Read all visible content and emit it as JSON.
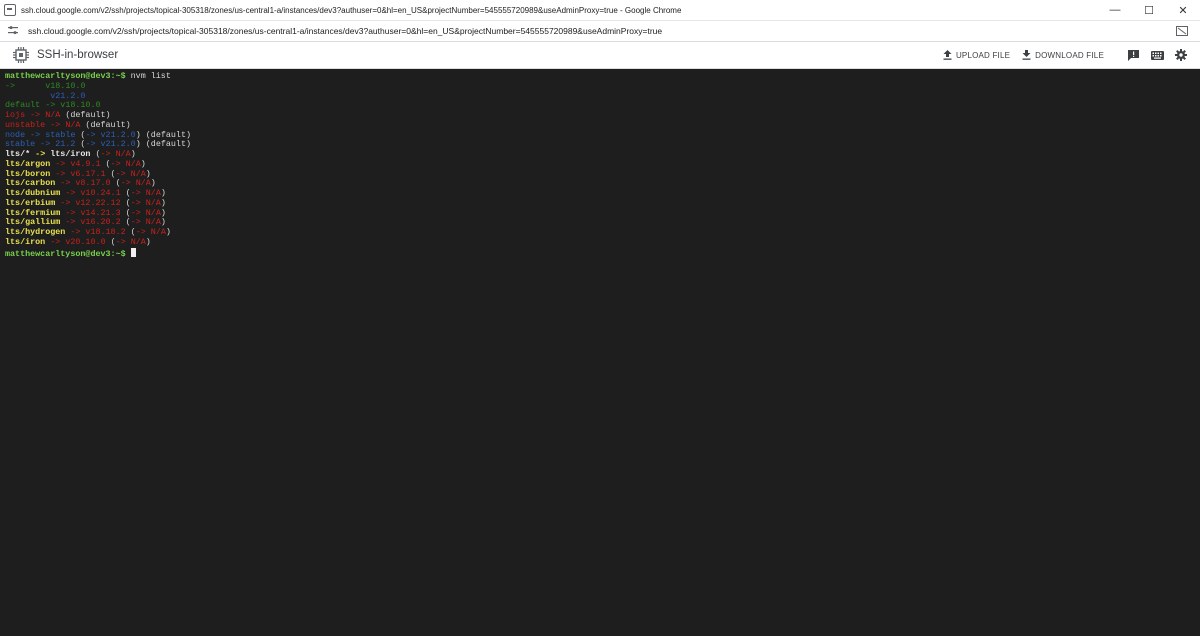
{
  "window": {
    "title": "ssh.cloud.google.com/v2/ssh/projects/topical-305318/zones/us-central1-a/instances/dev3?authuser=0&hl=en_US&projectNumber=545555720989&useAdminProxy=true - Google Chrome",
    "controls": {
      "minimize": "—",
      "maximize": "☐",
      "close": "✕"
    }
  },
  "address_bar": {
    "url": "ssh.cloud.google.com/v2/ssh/projects/topical-305318/zones/us-central1-a/instances/dev3?authuser=0&hl=en_US&projectNumber=545555720989&useAdminProxy=true"
  },
  "app_bar": {
    "title": "SSH-in-browser",
    "upload_label": "UPLOAD FILE",
    "download_label": "DOWNLOAD FILE",
    "icons": [
      "chip-icon",
      "upload-icon",
      "download-icon",
      "feedback-icon",
      "keyboard-icon",
      "gear-icon"
    ]
  },
  "terminal": {
    "prompt": "matthewcarltyson@dev3:~$",
    "command": " nvm list",
    "lines": {
      "l1": {
        "arrow": "->",
        "pad": "      ",
        "ver": "v18.10.0"
      },
      "l2": {
        "pad": "         ",
        "ver": "v21.2.0"
      },
      "l3": {
        "name": "default",
        "arrow": " -> ",
        "ver": "v18.10.0"
      },
      "l4": {
        "name": "iojs",
        "arrow": " -> ",
        "val": "N/A",
        "suffix": " (default)"
      },
      "l5": {
        "name": "unstable",
        "arrow": " -> ",
        "val": "N/A",
        "suffix": " (default)"
      },
      "l6": {
        "name": "node",
        "arrow": " -> ",
        "val": "stable",
        "open": " (",
        "arrow2": "->",
        "ver": " v21.2.0",
        "close": ")",
        "suffix": " (default)"
      },
      "l7": {
        "name": "stable",
        "arrow": " -> ",
        "val": "21.2",
        "open": " (",
        "arrow2": "->",
        "ver": " v21.2.0",
        "close": ")",
        "suffix": " (default)"
      },
      "l8": {
        "name": "lts/*",
        "arrow": " -> ",
        "val": "lts/iron",
        "open": " (",
        "arrow2": "->",
        "na": " N/A",
        "close": ")"
      },
      "lts": [
        {
          "name": "lts/argon",
          "ver": "v4.9.1"
        },
        {
          "name": "lts/boron",
          "ver": "v6.17.1"
        },
        {
          "name": "lts/carbon",
          "ver": "v8.17.0"
        },
        {
          "name": "lts/dubnium",
          "ver": "v10.24.1"
        },
        {
          "name": "lts/erbium",
          "ver": "v12.22.12"
        },
        {
          "name": "lts/fermium",
          "ver": "v14.21.3"
        },
        {
          "name": "lts/gallium",
          "ver": "v16.20.2"
        },
        {
          "name": "lts/hydrogen",
          "ver": "v18.18.2"
        },
        {
          "name": "lts/iron",
          "ver": "v20.10.0"
        }
      ],
      "lts_arrow": " -> ",
      "lts_open": " (",
      "lts_arrow2": "->",
      "lts_na": " N/A",
      "lts_close": ")"
    }
  },
  "colors": {
    "prompt": "#78d24b",
    "version_dark_green": "#2c8a24",
    "red": "#c8211b",
    "blue": "#2a5fb8",
    "yellow": "#e8e04f",
    "terminal_bg": "#1e1e1e"
  }
}
